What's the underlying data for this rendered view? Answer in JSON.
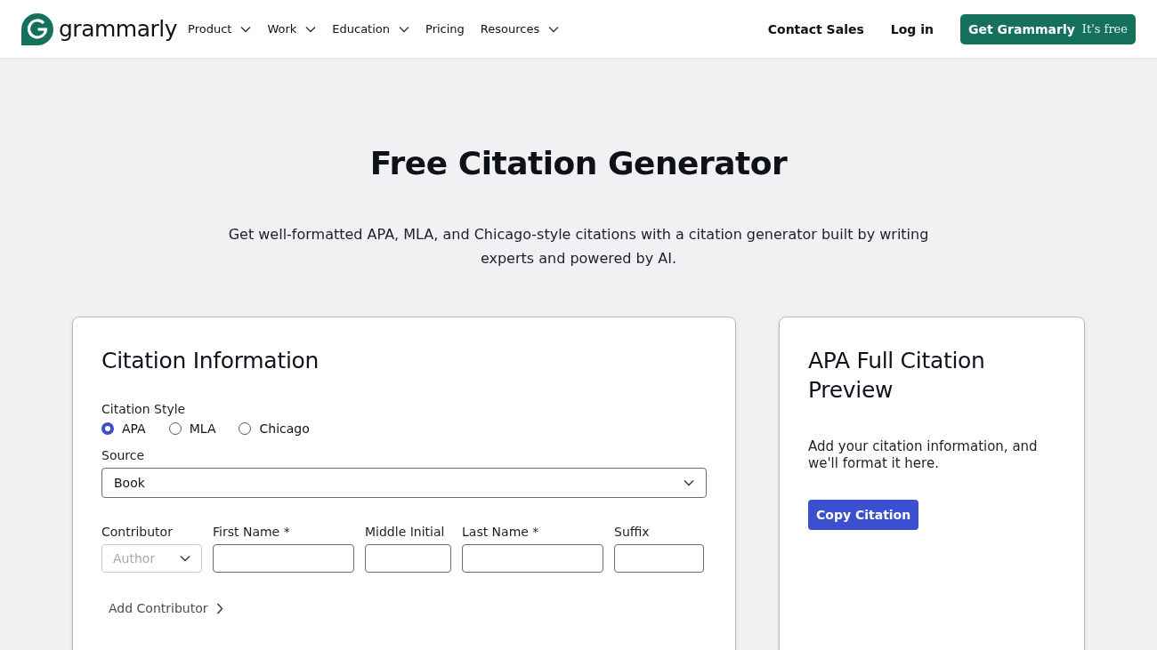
{
  "header": {
    "logo_text": "grammarly",
    "nav": [
      {
        "label": "Product",
        "has_menu": true
      },
      {
        "label": "Work",
        "has_menu": true
      },
      {
        "label": "Education",
        "has_menu": true
      },
      {
        "label": "Pricing",
        "has_menu": false
      },
      {
        "label": "Resources",
        "has_menu": true
      }
    ],
    "contact_sales": "Contact Sales",
    "log_in": "Log in",
    "cta": {
      "label": "Get Grammarly",
      "note": "It's free"
    }
  },
  "hero": {
    "title": "Free Citation Generator",
    "subtitle": "Get well-formatted APA, MLA, and Chicago-style citations with a citation generator built by writing experts and powered by AI."
  },
  "form": {
    "title": "Citation Information",
    "style_label": "Citation Style",
    "styles": [
      {
        "label": "APA",
        "selected": true
      },
      {
        "label": "MLA",
        "selected": false
      },
      {
        "label": "Chicago",
        "selected": false
      }
    ],
    "source_label": "Source",
    "source_value": "Book",
    "contributor": {
      "label": "Contributor",
      "value": "Author",
      "disabled": true
    },
    "name_fields": [
      {
        "label": "First Name *"
      },
      {
        "label": "Middle Initial"
      },
      {
        "label": "Last Name *"
      },
      {
        "label": "Suffix"
      }
    ],
    "add_contributor": "Add Contributor"
  },
  "preview": {
    "title": "APA Full Citation Preview",
    "text": "Add your citation information, and we'll format it here.",
    "button": "Copy Citation"
  }
}
